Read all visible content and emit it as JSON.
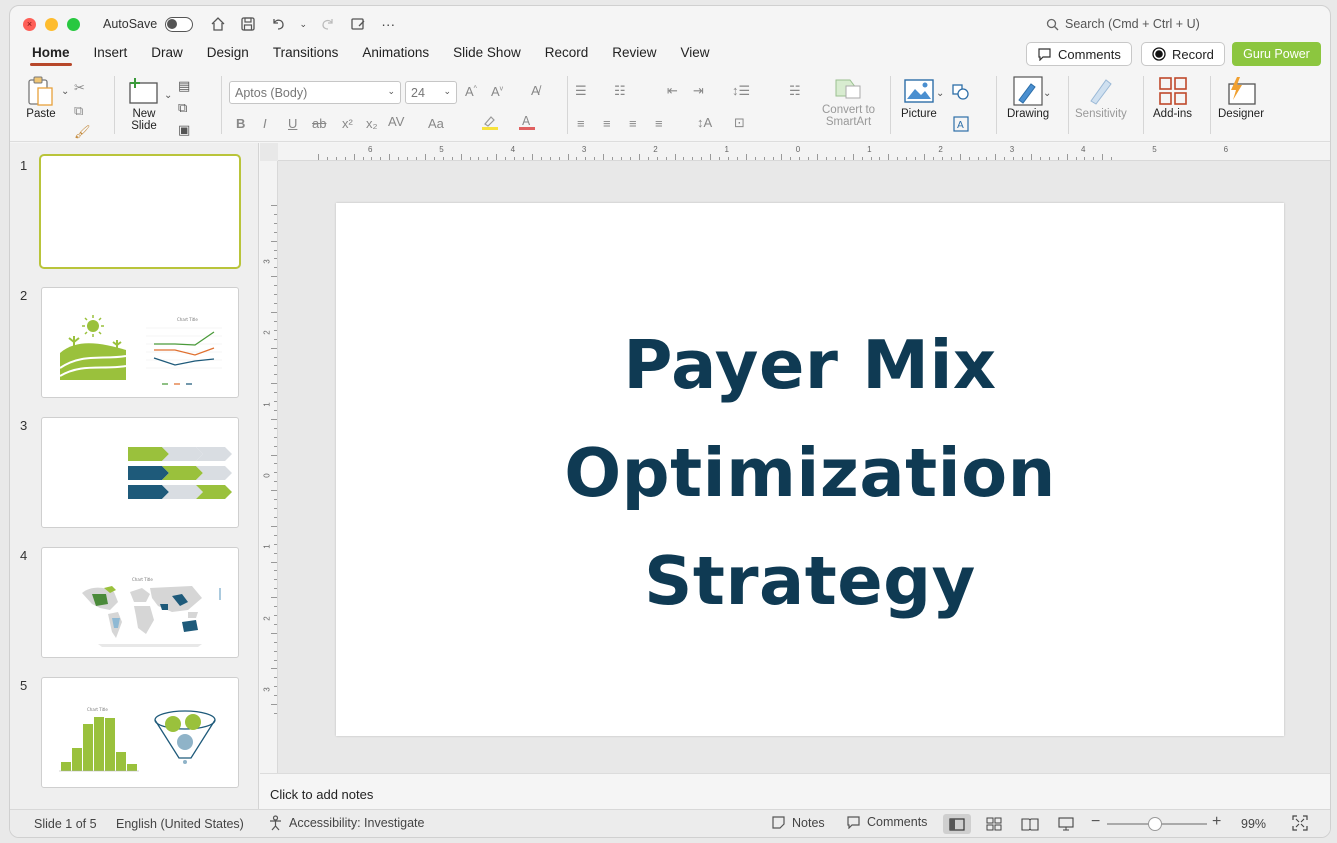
{
  "titlebar": {
    "autosave_label": "AutoSave",
    "search_placeholder": "Search (Cmd + Ctrl + U)"
  },
  "ribbon_tabs": [
    "Home",
    "Insert",
    "Draw",
    "Design",
    "Transitions",
    "Animations",
    "Slide Show",
    "Record",
    "Review",
    "View"
  ],
  "ribbon_buttons": {
    "comments": "Comments",
    "record": "Record",
    "guru": "Guru Power"
  },
  "ribbon": {
    "paste": "Paste",
    "new_slide_line1": "New",
    "new_slide_line2": "Slide",
    "font_name": "Aptos (Body)",
    "font_size": "24",
    "convert_line1": "Convert to",
    "convert_line2": "SmartArt",
    "picture": "Picture",
    "drawing": "Drawing",
    "sensitivity": "Sensitivity",
    "addins": "Add-ins",
    "designer": "Designer"
  },
  "thumbnails": [
    {
      "number": "1"
    },
    {
      "number": "2",
      "chart_title": "Chart Title"
    },
    {
      "number": "3"
    },
    {
      "number": "4",
      "chart_title": "Chart Title"
    },
    {
      "number": "5",
      "chart_title": "Chart Title"
    }
  ],
  "ruler": {
    "h_labels": [
      "6",
      "5",
      "4",
      "3",
      "2",
      "1",
      "0",
      "1",
      "2",
      "3",
      "4",
      "5",
      "6"
    ],
    "v_labels": [
      "3",
      "2",
      "1",
      "0",
      "1",
      "2",
      "3"
    ]
  },
  "slide": {
    "title_lines": [
      "Payer Mix",
      "Optimization",
      "Strategy"
    ],
    "title_color": "#0f3a53"
  },
  "notes_placeholder": "Click to add notes",
  "status": {
    "slide_count": "Slide 1 of 5",
    "language": "English (United States)",
    "accessibility": "Accessibility: Investigate",
    "notes": "Notes",
    "comments": "Comments",
    "zoom": "99%"
  },
  "colors": {
    "accent_green": "#8cc63f",
    "tab_underline": "#b7472a",
    "navy": "#1e5a7a"
  }
}
